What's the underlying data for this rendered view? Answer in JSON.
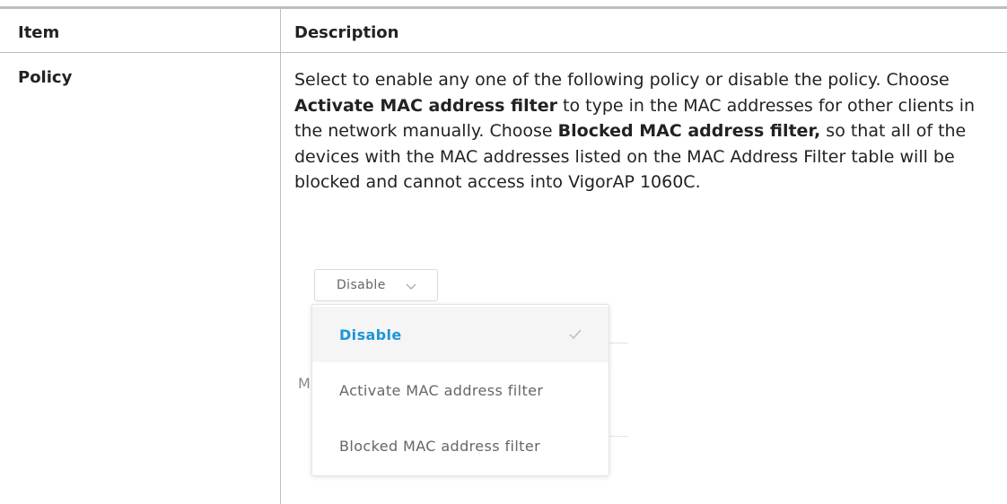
{
  "table": {
    "header_item": "Item",
    "header_description": "Description",
    "row": {
      "item": "Policy",
      "desc_part1": "Select to enable any one of the following policy or disable the policy. Choose ",
      "desc_bold1": "Activate MAC address filter",
      "desc_part2": " to type in the MAC addresses for other clients in the network manually. Choose ",
      "desc_bold2": "Blocked MAC address filter,",
      "desc_part3": " so that all of the devices with the MAC addresses listed on the MAC Address Filter table will be blocked and cannot access into VigorAP 1060C."
    }
  },
  "policy_select": {
    "value": "Disable",
    "icon": "chevron-down-icon",
    "options": [
      {
        "label": "Disable",
        "selected": true
      },
      {
        "label": "Activate MAC address filter",
        "selected": false
      },
      {
        "label": "Blocked MAC address filter",
        "selected": false
      }
    ],
    "accent_color": "#1c95d8",
    "background_partial_label": "M"
  }
}
